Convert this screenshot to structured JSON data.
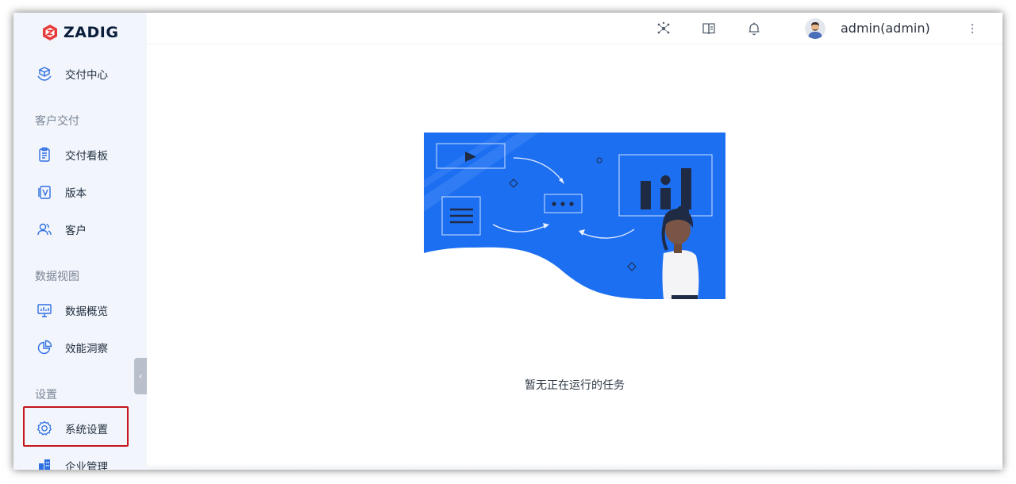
{
  "app": {
    "logo_text": "ZADIG",
    "brand_color": "#e63b3b"
  },
  "sidebar": {
    "items": [
      {
        "label": "交付中心",
        "icon": "delivery-center-icon"
      },
      {
        "label": "交付看板",
        "icon": "clipboard-icon"
      },
      {
        "label": "版本",
        "icon": "version-icon"
      },
      {
        "label": "客户",
        "icon": "users-icon"
      },
      {
        "label": "数据概览",
        "icon": "monitor-chart-icon"
      },
      {
        "label": "效能洞察",
        "icon": "pie-chart-icon"
      },
      {
        "label": "系统设置",
        "icon": "gear-icon"
      },
      {
        "label": "企业管理",
        "icon": "building-icon"
      }
    ],
    "sections": {
      "customer_delivery": "客户交付",
      "data_view": "数据视图",
      "settings": "设置"
    }
  },
  "header": {
    "icons": [
      "plugin-hub-icon",
      "book-icon",
      "bell-icon",
      "more-vertical-icon"
    ],
    "username": "admin(admin)"
  },
  "main": {
    "empty_message": "暂无正在运行的任务"
  },
  "colors": {
    "accent_blue": "#1d6ff2",
    "highlight_red": "#c4161c",
    "sidebar_bg": "#f2f5fb"
  }
}
